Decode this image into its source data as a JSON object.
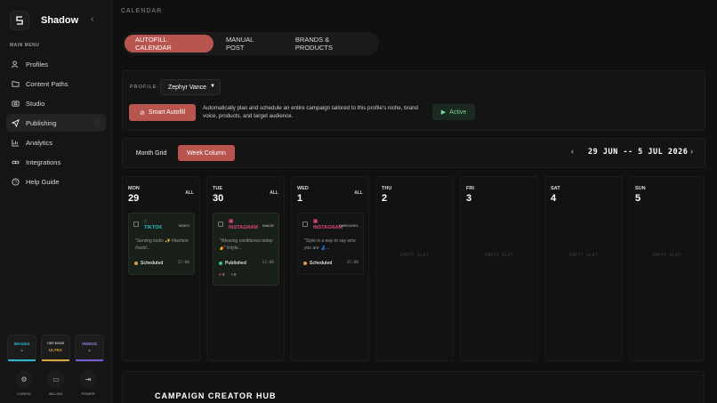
{
  "sidebar": {
    "brand": "Shadow",
    "menu_label": "MAIN MENU",
    "items": [
      {
        "label": "Profiles",
        "icon": "users-icon"
      },
      {
        "label": "Content Paths",
        "icon": "folder-icon"
      },
      {
        "label": "Studio",
        "icon": "camera-icon"
      },
      {
        "label": "Publishing",
        "icon": "send-icon",
        "active": true
      },
      {
        "label": "Analytics",
        "icon": "chart-icon"
      },
      {
        "label": "Integrations",
        "icon": "link-icon"
      },
      {
        "label": "Help Guide",
        "icon": "help-icon"
      }
    ],
    "quotas": [
      {
        "label": "IMAGES",
        "value": "-",
        "color": "#2fb5c9"
      },
      {
        "label": "TIER MODE",
        "value": "ULTRA",
        "color": "#d9a53a"
      },
      {
        "label": "VIDEOS",
        "value": "-",
        "color": "#7c5cd6"
      }
    ],
    "utils": [
      {
        "label": "CONFIG"
      },
      {
        "label": "BILLING"
      },
      {
        "label": "POWER"
      }
    ]
  },
  "header": {
    "breadcrumb": "CALENDAR"
  },
  "tabs": [
    {
      "label": "AUTOFILL CALENDAR",
      "active": true
    },
    {
      "label": "MANUAL POST"
    },
    {
      "label": "BRANDS & PRODUCTS"
    }
  ],
  "autofill": {
    "profile_label": "PROFILE:",
    "profile_value": "Zephyr Vance",
    "button": "Smart Autofill",
    "description": "Automatically plan and schedule an entire campaign tailored to this profile's niche, brand voice, products, and target audience.",
    "status": "Active"
  },
  "calendar": {
    "view_month": "Month Grid",
    "view_week": "Week Column",
    "range": "29 JUN -- 5 JUL 2026",
    "days": [
      {
        "name": "MON",
        "date": "29",
        "all": "ALL"
      },
      {
        "name": "TUE",
        "date": "30",
        "all": "ALL"
      },
      {
        "name": "WED",
        "date": "1",
        "all": "ALL"
      },
      {
        "name": "THU",
        "date": "2",
        "empty": "EMPTY SLOT"
      },
      {
        "name": "FRI",
        "date": "3",
        "empty": "EMPTY SLOT"
      },
      {
        "name": "SAT",
        "date": "4",
        "empty": "EMPTY SLOT"
      },
      {
        "name": "SUN",
        "date": "5",
        "empty": "EMPTY SLOT"
      }
    ],
    "posts": [
      {
        "platform": "TIKTOK",
        "type": "VIDEO",
        "caption": "\"Serving looks ✨ #fashion #ootd...",
        "status": "Scheduled",
        "time": "15:00",
        "color": "#2fb5c9"
      },
      {
        "platform": "INSTAGRAM",
        "type": "IMAGE",
        "caption": "\"Wearing confidence today 💅 #style...",
        "status": "Published",
        "time": "13:00",
        "color": "#d9457a",
        "likes": "0",
        "comments": "0"
      },
      {
        "platform": "INSTAGRAM",
        "type": "CAROUSEL",
        "caption": "\"Style is a way to say who you are 👗...",
        "status": "Scheduled",
        "time": "15:00",
        "color": "#d9457a"
      }
    ]
  },
  "hub": {
    "title": "CAMPAIGN CREATOR HUB"
  }
}
